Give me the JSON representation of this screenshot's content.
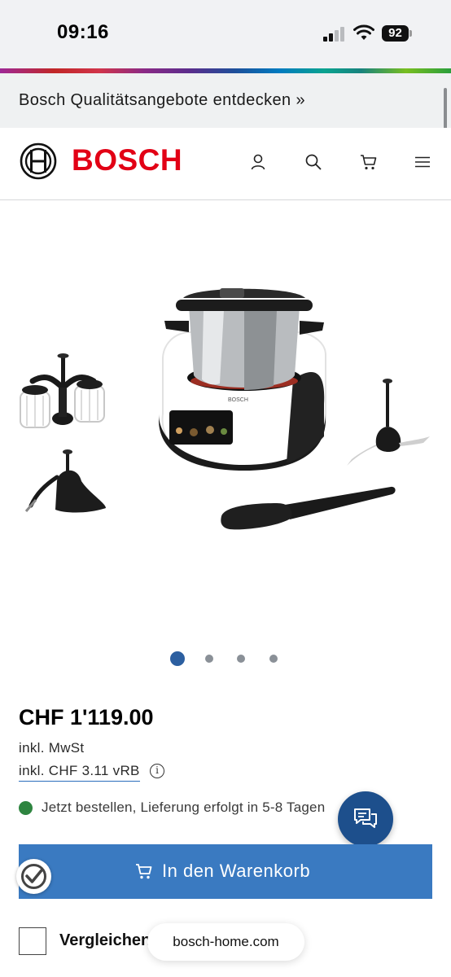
{
  "status_bar": {
    "time": "09:16",
    "battery": "92"
  },
  "promo": {
    "text": "Bosch Qualitätsangebote entdecken »"
  },
  "header": {
    "logo_text": "BOSCH"
  },
  "gallery": {
    "slide_count": 4,
    "active_slide": 1
  },
  "product": {
    "price": "CHF 1'119.00",
    "vat_note": "inkl. MwSt",
    "vrb_note": "inkl. CHF 3.11 vRB",
    "info_glyph": "i",
    "availability": "Jetzt bestellen, Lieferung erfolgt in 5-8 Tagen"
  },
  "actions": {
    "add_to_cart": "In den Warenkorb",
    "compare": "Vergleichen"
  },
  "browser": {
    "url": "bosch-home.com"
  },
  "colors": {
    "brand_red": "#e20015",
    "button_blue": "#3a7ac1",
    "chat_blue": "#1d4f8c",
    "available_green": "#2e8540"
  }
}
